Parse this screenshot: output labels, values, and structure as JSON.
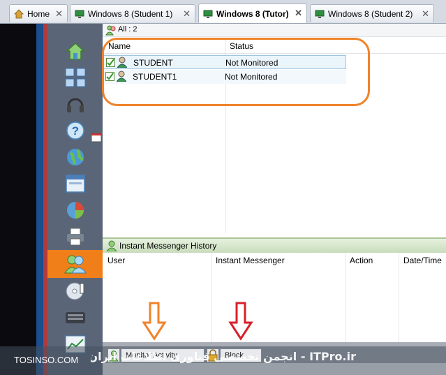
{
  "tabs": [
    {
      "label": "Home",
      "active": false
    },
    {
      "label": "Windows 8 (Student 1)",
      "active": false
    },
    {
      "label": "Windows 8 (Tutor)",
      "active": true
    },
    {
      "label": "Windows 8 (Student 2)",
      "active": false
    }
  ],
  "close_glyph": "✕",
  "group_filter": "All : 2",
  "table": {
    "columns": [
      "Name",
      "Status"
    ],
    "rows": [
      {
        "name": "STUDENT",
        "status": "Not Monitored"
      },
      {
        "name": "STUDENT1",
        "status": "Not Monitored"
      }
    ]
  },
  "im_history": {
    "title": "Instant Messenger History",
    "columns": [
      "User",
      "Instant Messenger",
      "Action",
      "Date/Time"
    ]
  },
  "toolbar": {
    "monitor_label": "Monitor Activity",
    "block_label": "Block"
  },
  "watermark": {
    "left": "TOSINSO.COM",
    "right": "ITPro.ir - انجمن تخصصی فناوری اطلاعات ایران"
  },
  "colors": {
    "accent_orange": "#f07f1a",
    "highlight_orange": "#f0832a",
    "arrow_red": "#d8202a",
    "sidebar_bg": "#5a6678"
  }
}
